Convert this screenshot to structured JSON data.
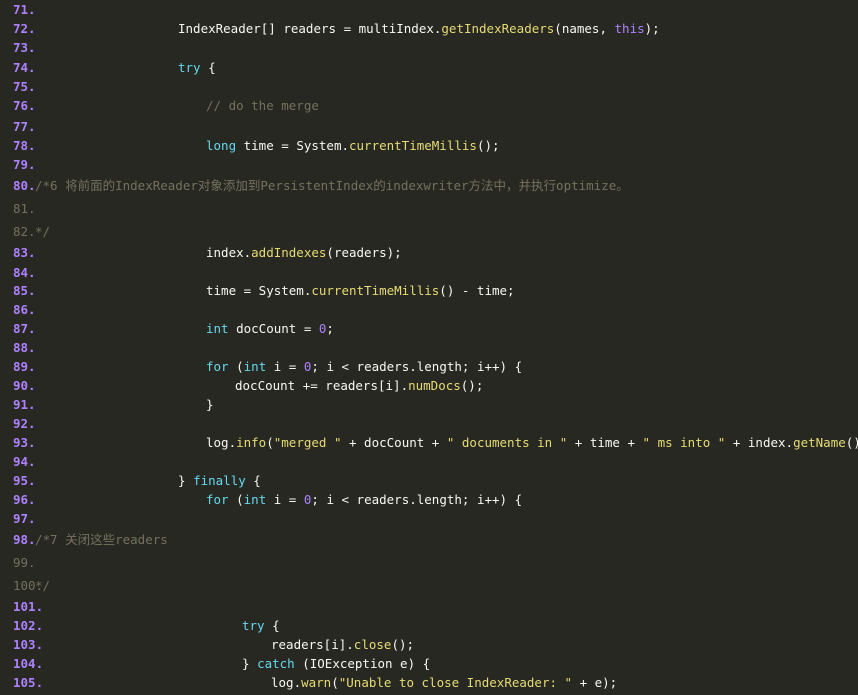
{
  "colors": {
    "background": "#272822",
    "line_number": "#ae81ff",
    "line_number_comment": "#75715e",
    "text": "#f8f8f2",
    "keyword": "#66d9ef",
    "function": "#e6db74",
    "string": "#e6db74",
    "number": "#ae81ff",
    "comment": "#75715e"
  },
  "lines": [
    {
      "num": "71.",
      "tokens": []
    },
    {
      "num": "72.",
      "tokens": [
        [
          "plain",
          "IndexReader[] readers = multiIndex."
        ],
        [
          "fn",
          "getIndexReaders"
        ],
        [
          "plain",
          "(names, "
        ],
        [
          "this",
          "this"
        ],
        [
          "plain",
          ");"
        ]
      ]
    },
    {
      "num": "73.",
      "tokens": []
    },
    {
      "num": "74.",
      "tokens": [
        [
          "kw",
          "try"
        ],
        [
          "plain",
          " {"
        ]
      ]
    },
    {
      "num": "75.",
      "tokens": []
    },
    {
      "num": "76.",
      "tokens": [
        [
          "cm",
          "// do the merge"
        ]
      ]
    },
    {
      "num": "77.",
      "tokens": []
    },
    {
      "num": "78.",
      "tokens": [
        [
          "kw",
          "long"
        ],
        [
          "plain",
          " time = System."
        ],
        [
          "fn",
          "currentTimeMillis"
        ],
        [
          "plain",
          "();"
        ]
      ]
    },
    {
      "num": "79.",
      "tokens": []
    },
    {
      "num": "80.",
      "tokens": [
        [
          "cm",
          "/*6 将前面的IndexReader对象添加到PersistentIndex的indexwriter方法中，并执行optimize。"
        ]
      ]
    },
    {
      "num": "81.",
      "tokens": []
    },
    {
      "num": "82.",
      "tokens": [
        [
          "cm",
          "*/"
        ]
      ]
    },
    {
      "num": "83.",
      "tokens": [
        [
          "plain",
          "index."
        ],
        [
          "fn",
          "addIndexes"
        ],
        [
          "plain",
          "(readers);"
        ]
      ]
    },
    {
      "num": "84.",
      "tokens": []
    },
    {
      "num": "85.",
      "tokens": [
        [
          "plain",
          "time = System."
        ],
        [
          "fn",
          "currentTimeMillis"
        ],
        [
          "plain",
          "() - time;"
        ]
      ]
    },
    {
      "num": "86.",
      "tokens": []
    },
    {
      "num": "87.",
      "tokens": [
        [
          "kw",
          "int"
        ],
        [
          "plain",
          " docCount = "
        ],
        [
          "num",
          "0"
        ],
        [
          "plain",
          ";"
        ]
      ]
    },
    {
      "num": "88.",
      "tokens": []
    },
    {
      "num": "89.",
      "tokens": [
        [
          "kw",
          "for"
        ],
        [
          "plain",
          " ("
        ],
        [
          "kw",
          "int"
        ],
        [
          "plain",
          " i = "
        ],
        [
          "num",
          "0"
        ],
        [
          "plain",
          "; i < readers.length; i++) {"
        ]
      ]
    },
    {
      "num": "90.",
      "tokens": [
        [
          "plain",
          "docCount += readers[i]."
        ],
        [
          "fn",
          "numDocs"
        ],
        [
          "plain",
          "();"
        ]
      ]
    },
    {
      "num": "91.",
      "tokens": [
        [
          "plain",
          "}"
        ]
      ]
    },
    {
      "num": "92.",
      "tokens": []
    },
    {
      "num": "93.",
      "tokens": [
        [
          "plain",
          "log."
        ],
        [
          "fn",
          "info"
        ],
        [
          "plain",
          "("
        ],
        [
          "str",
          "\"merged \""
        ],
        [
          "plain",
          " + docCount + "
        ],
        [
          "str",
          "\" documents in \""
        ],
        [
          "plain",
          " + time + "
        ],
        [
          "str",
          "\" ms into \""
        ],
        [
          "plain",
          " + index."
        ],
        [
          "fn",
          "getName"
        ],
        [
          "plain",
          "() + "
        ],
        [
          "str",
          "\""
        ]
      ]
    },
    {
      "num": "94.",
      "tokens": []
    },
    {
      "num": "95.",
      "tokens": [
        [
          "plain",
          "} "
        ],
        [
          "kw",
          "finally"
        ],
        [
          "plain",
          " {"
        ]
      ]
    },
    {
      "num": "96.",
      "tokens": [
        [
          "kw",
          "for"
        ],
        [
          "plain",
          " ("
        ],
        [
          "kw",
          "int"
        ],
        [
          "plain",
          " i = "
        ],
        [
          "num",
          "0"
        ],
        [
          "plain",
          "; i < readers.length; i++) {"
        ]
      ]
    },
    {
      "num": "97.",
      "tokens": []
    },
    {
      "num": "98.",
      "tokens": [
        [
          "cm",
          "/*7 关闭这些readers"
        ]
      ]
    },
    {
      "num": "99.",
      "tokens": []
    },
    {
      "num": "100.",
      "tokens": [
        [
          "cm",
          "*/"
        ]
      ]
    },
    {
      "num": "101.",
      "tokens": []
    },
    {
      "num": "102.",
      "tokens": [
        [
          "kw",
          "try"
        ],
        [
          "plain",
          " {"
        ]
      ]
    },
    {
      "num": "103.",
      "tokens": [
        [
          "plain",
          "readers[i]."
        ],
        [
          "fn",
          "close"
        ],
        [
          "plain",
          "();"
        ]
      ]
    },
    {
      "num": "104.",
      "tokens": [
        [
          "plain",
          "} "
        ],
        [
          "kw",
          "catch"
        ],
        [
          "plain",
          " (IOException e) {"
        ]
      ]
    },
    {
      "num": "105.",
      "tokens": [
        [
          "plain",
          "log."
        ],
        [
          "fn",
          "warn"
        ],
        [
          "plain",
          "("
        ],
        [
          "str",
          "\"Unable to close IndexReader: \""
        ],
        [
          "plain",
          " + e);"
        ]
      ]
    }
  ]
}
